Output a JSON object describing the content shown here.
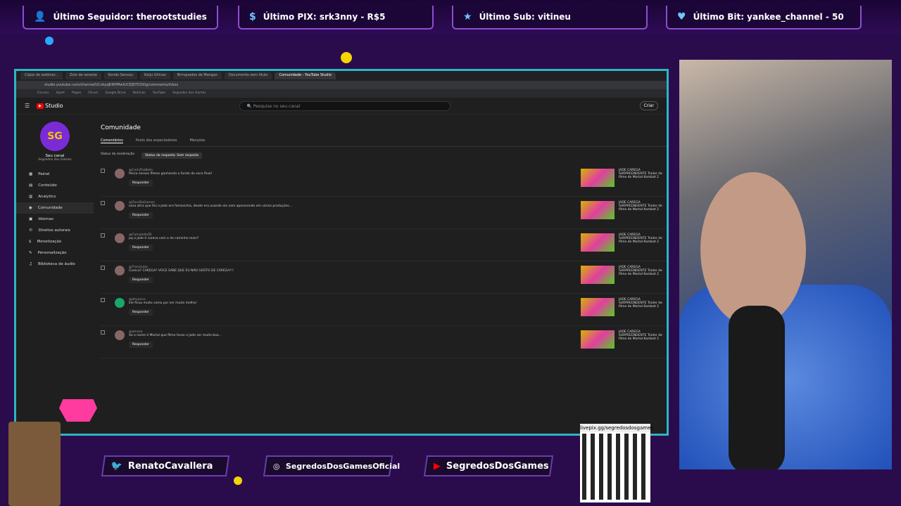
{
  "alerts": {
    "follower": "Último Seguidor: therootstudies",
    "pix": "Último PIX: srk3nny - R$5",
    "sub": "Último Sub: vitineu",
    "bit": "Último Bit: yankee_channel - 50"
  },
  "browser": {
    "tabs": [
      "Cópia de webinar...",
      "Zoio de seresta",
      "Kondo Sensou",
      "Kaiju Ulricas",
      "Brinquedos de Mangas",
      "Documento sem título",
      "Comunidade - YouTube Studio"
    ],
    "url": "studio.youtube.com/channel/UCxkyqE4tPMwIUCEjB7D3IOg/comments/inbox",
    "bookmarks": [
      "Forums",
      "Xpert",
      "Pages",
      "Fórum",
      "Google Drive",
      "Notícias",
      "YouTube",
      "Segredos dos Games"
    ]
  },
  "studio": {
    "logo": "Studio",
    "search_placeholder": "Pesquise no seu canal",
    "create": "Criar",
    "channel_name": "Seu canal",
    "channel_handle": "Segredos dos Games",
    "nav": [
      "Painel",
      "Conteúdo",
      "Analytics",
      "Comunidade",
      "Idiomas",
      "Direitos autorais",
      "Monetização",
      "Personalização",
      "Biblioteca de áudio"
    ],
    "title": "Comunidade",
    "tabs": [
      "Comentários",
      "Posts dos espectadores",
      "Menções"
    ],
    "filter_label": "Status da moderação",
    "filter_chip": "Status da resposta: Sem resposta",
    "reply": "Responder",
    "comments": [
      {
        "author": "@ComZhaBeto",
        "text": "Perca nesses filmes ganhando o fundo do soco final!",
        "video": "JADE CAREGA SURPREENDENTE Trailer de filme de Mortal Kombat 2"
      },
      {
        "author": "@ZeroDoGames",
        "text": "essa atriz que fez a jade era famosinha, desde era usando ela vem aparecendo em vários produções...",
        "video": "JADE CAREGA SURPREENDENTE Trailer de filme de Mortal Kombat 2"
      },
      {
        "author": "@Camaleão95",
        "text": "pq a jade é careca com a de caminho mais?",
        "video": "JADE CAREGA SURPREENDENTE Trailer de filme de Mortal Kombat 2"
      },
      {
        "author": "@Transtutor",
        "text": "Careca? CAREGA? VOCE SABE QUE EU NÃO GOSTO DE CAREGA!!!",
        "video": "JADE CAREGA SURPREENDENTE Trailer de filme de Mortal Kombat 2"
      },
      {
        "author": "@ahyoovo",
        "text": "Ele ficou muito como por ser muito melhor",
        "video": "JADE CAREGA SURPREENDENTE Trailer de filme de Mortal Kombat 2"
      },
      {
        "author": "@amoza",
        "text": "Se o nome é Mortal que filme fosse a Jade ser muito boa...",
        "video": "JADE CAREGA SURPREENDENTE Trailer de filme de Mortal Kombat 2"
      }
    ]
  },
  "socials": {
    "twitter": "RenatoCavallera",
    "instagram": "SegredosDosGamesOficial",
    "youtube": "SegredosDosGames"
  },
  "qr": {
    "label": "livepix.gg/segredosdosgames"
  },
  "colors": {
    "bg": "#2a0c4d",
    "frame": "#2fb4c4",
    "accent": "#8a4fd0"
  }
}
